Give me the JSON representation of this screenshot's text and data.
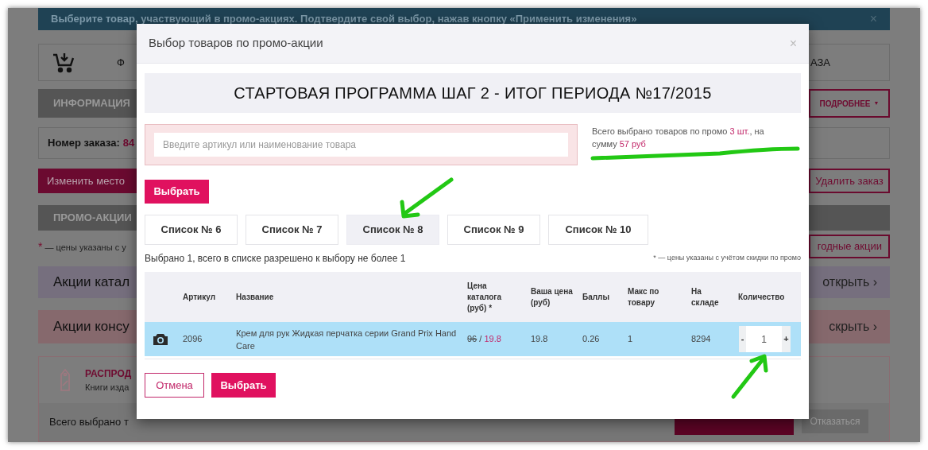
{
  "page": {
    "notice": {
      "text": "Выберите товар, участвующий в промо-акциях. Подтвердите свой выбор, нажав кнопку «Применить изменения»",
      "close": "×"
    },
    "cart_bar": {
      "left_text": "Ф",
      "right_text": "АЗА"
    },
    "info_bar": {
      "title": "ИНФОРМАЦИЯ",
      "button": "ПОДРОБНЕЕ",
      "caret": "▼"
    },
    "order": {
      "label": "Номер заказа:",
      "value": "84"
    },
    "actions": {
      "change": "Изменить место",
      "delete": "Удалить заказ"
    },
    "promo_bar": {
      "title": "ПРОМО-АКЦИИ"
    },
    "note": {
      "mark": "*",
      "text": "— цены указаны с у",
      "button": "годные акции"
    },
    "sections": [
      {
        "title": "Акции катал",
        "toggle": "открыть",
        "arrow": "›",
        "color": "#766f7e"
      },
      {
        "title": "Акции консу",
        "toggle": "скрыть",
        "arrow": "›",
        "color": "#86696d"
      }
    ],
    "sale_card": {
      "title": "РАСПРОД",
      "subtitle": "Книги изда",
      "summary": "Всего выбрано т",
      "decline": "Отказаться"
    }
  },
  "modal": {
    "title": "Выбор товаров по промо-акции",
    "close": "×",
    "promo_title": "СТАРТОВАЯ ПРОГРАММА ШАГ 2 - ИТОГ ПЕРИОДА №17/2015",
    "search": {
      "placeholder": "Введите артикул или наименование товара"
    },
    "summary": {
      "prefix": "Всего выбрано товаров по промо ",
      "count": "3 шт.",
      "middle": ", на сумму ",
      "sum": "57 руб"
    },
    "select_button": "Выбрать",
    "tabs": [
      {
        "label": "Список № 6",
        "selected": false
      },
      {
        "label": "Список № 7",
        "selected": false
      },
      {
        "label": "Список № 8",
        "selected": true
      },
      {
        "label": "Список № 9",
        "selected": false
      },
      {
        "label": "Список № 10",
        "selected": false
      }
    ],
    "selection_note": "Выбрано 1, всего в списке разрешено к выбору не более 1",
    "price_note": "* — цены указаны с учётом скидки по промо",
    "table": {
      "columns": [
        "Артикул",
        "Название",
        "Цена каталога (руб) *",
        "Ваша цена (руб)",
        "Баллы",
        "Макс по товару",
        "На складе",
        "Количество"
      ],
      "rows": [
        {
          "selected": true,
          "article": "2096",
          "name": "Крем для рук Жидкая перчатка серии Grand Prix Hand Care",
          "catalog_price_old": "96",
          "price_separator": "/",
          "catalog_price": "19.8",
          "your_price": "19.8",
          "points": "0.26",
          "max": "1",
          "stock": "8294",
          "minus": "-",
          "quantity": "1",
          "plus": "+"
        }
      ]
    },
    "buttons": {
      "cancel": "Отмена",
      "confirm": "Выбрать"
    }
  }
}
